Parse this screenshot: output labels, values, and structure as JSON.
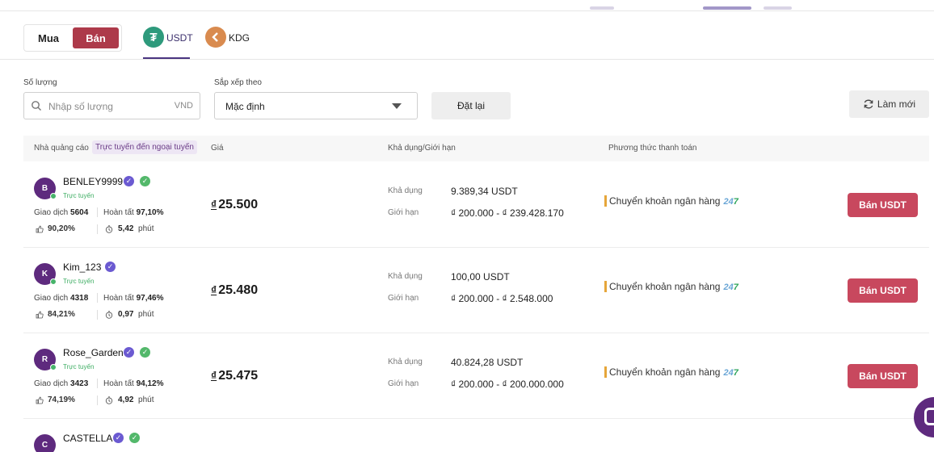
{
  "toggle": {
    "buy_label": "Mua",
    "sell_label": "Bán"
  },
  "coins": [
    {
      "icon": "tether-icon",
      "label": "USDT",
      "active": true
    },
    {
      "icon": "kdg-icon",
      "label": "KDG",
      "active": false
    }
  ],
  "filters": {
    "quantity_label": "Số lượng",
    "quantity_placeholder": "Nhập số lượng",
    "quantity_unit": "VND",
    "sort_label": "Sắp xếp theo",
    "sort_value": "Mặc định",
    "reset_label": "Đặt lại",
    "refresh_label": "Làm mới"
  },
  "table_header": {
    "advertiser": "Nhà quảng cáo",
    "online_filter": "Trực tuyến đến ngoại tuyến",
    "price": "Giá",
    "available_limit": "Khả dụng/Giới hạn",
    "payment_method": "Phương thức thanh toán"
  },
  "labels": {
    "trades": "Giao dịch",
    "completion": "Hoàn tất",
    "minutes": "phút",
    "available": "Khả dụng",
    "limit": "Giới hạn",
    "online": "Trực tuyến",
    "payment_name": "Chuyển khoản ngân hàng",
    "payment_badge_a": "24",
    "payment_badge_b": "7",
    "sell_button": "Bán USDT"
  },
  "rows": [
    {
      "initial": "B",
      "name": "BENLEY9999",
      "green_badge": true,
      "trades": "5604",
      "completion": "97,10%",
      "like_rate": "90,20%",
      "time": "5,42",
      "price_symbol": "₫",
      "price": "25.500",
      "available": "9.389,34 USDT",
      "limit": "₫ 200.000 - ₫ 239.428.170"
    },
    {
      "initial": "K",
      "name": "Kim_123",
      "green_badge": false,
      "trades": "4318",
      "completion": "97,46%",
      "like_rate": "84,21%",
      "time": "0,97",
      "price_symbol": "₫",
      "price": "25.480",
      "available": "100,00 USDT",
      "limit": "₫ 200.000 - ₫ 2.548.000"
    },
    {
      "initial": "R",
      "name": "Rose_Garden",
      "green_badge": true,
      "trades": "3423",
      "completion": "94,12%",
      "like_rate": "74,19%",
      "time": "4,92",
      "price_symbol": "₫",
      "price": "25.475",
      "available": "40.824,28 USDT",
      "limit": "₫ 200.000 - ₫ 200.000.000"
    },
    {
      "initial": "C",
      "name": "CASTELLA",
      "green_badge": true
    }
  ],
  "colors": {
    "accent": "#ad3a4a",
    "sell_button": "#c8485e",
    "brand_purple": "#5e2a7e",
    "online_green": "#3fae64"
  }
}
